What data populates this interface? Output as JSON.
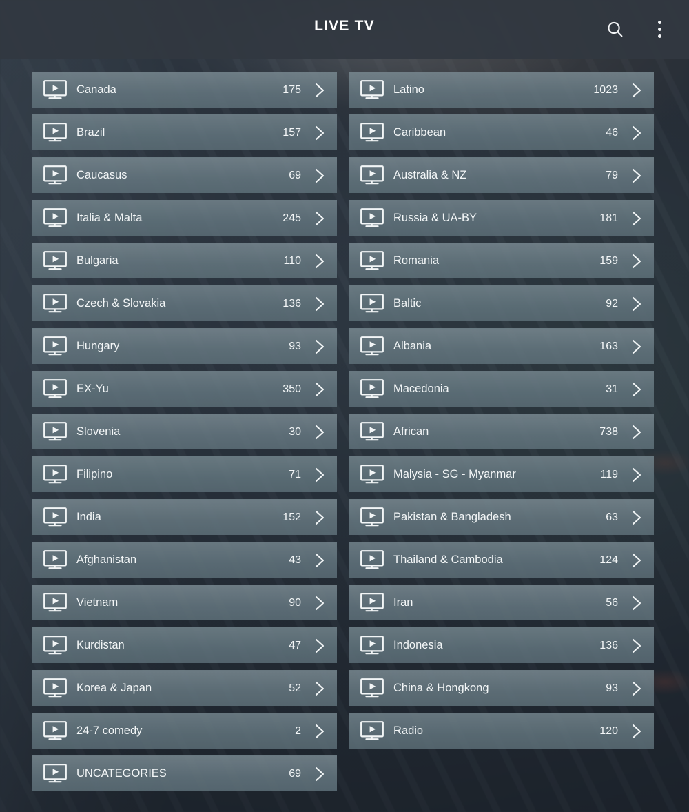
{
  "app": {
    "title": "LIVE TV",
    "theme": {
      "appbar_bg": "#323841",
      "row_bg": "#68787f",
      "page_bg": "#2f3945",
      "text": "#f3f6f7"
    }
  },
  "appbar": {
    "title": "LIVE TV",
    "search_icon": "search-icon",
    "overflow_icon": "more-vertical-icon"
  },
  "icons": {
    "row_leading": "tv-play-icon",
    "row_trailing": "chevron-right-icon"
  },
  "categories": {
    "left_column": [
      {
        "label": "Canada",
        "count": "175"
      },
      {
        "label": "Brazil",
        "count": "157"
      },
      {
        "label": "Caucasus",
        "count": "69"
      },
      {
        "label": "Italia & Malta",
        "count": "245"
      },
      {
        "label": "Bulgaria",
        "count": "110"
      },
      {
        "label": "Czech & Slovakia",
        "count": "136"
      },
      {
        "label": "Hungary",
        "count": "93"
      },
      {
        "label": "EX-Yu",
        "count": "350"
      },
      {
        "label": "Slovenia",
        "count": "30"
      },
      {
        "label": "Filipino",
        "count": "71"
      },
      {
        "label": "India",
        "count": "152"
      },
      {
        "label": "Afghanistan",
        "count": "43"
      },
      {
        "label": "Vietnam",
        "count": "90"
      },
      {
        "label": "Kurdistan",
        "count": "47"
      },
      {
        "label": "Korea & Japan",
        "count": "52"
      },
      {
        "label": "24-7 comedy",
        "count": "2"
      },
      {
        "label": "UNCATEGORIES",
        "count": "69"
      }
    ],
    "right_column": [
      {
        "label": "Latino",
        "count": "1023"
      },
      {
        "label": "Caribbean",
        "count": "46"
      },
      {
        "label": "Australia & NZ",
        "count": "79"
      },
      {
        "label": "Russia & UA-BY",
        "count": "181"
      },
      {
        "label": "Romania",
        "count": "159"
      },
      {
        "label": "Baltic",
        "count": "92"
      },
      {
        "label": "Albania",
        "count": "163"
      },
      {
        "label": "Macedonia",
        "count": "31"
      },
      {
        "label": "African",
        "count": "738"
      },
      {
        "label": "Malysia - SG - Myanmar",
        "count": "119"
      },
      {
        "label": "Pakistan & Bangladesh",
        "count": "63"
      },
      {
        "label": "Thailand & Cambodia",
        "count": "124"
      },
      {
        "label": "Iran",
        "count": "56"
      },
      {
        "label": "Indonesia",
        "count": "136"
      },
      {
        "label": "China & Hongkong",
        "count": "93"
      },
      {
        "label": "Radio",
        "count": "120"
      }
    ]
  }
}
